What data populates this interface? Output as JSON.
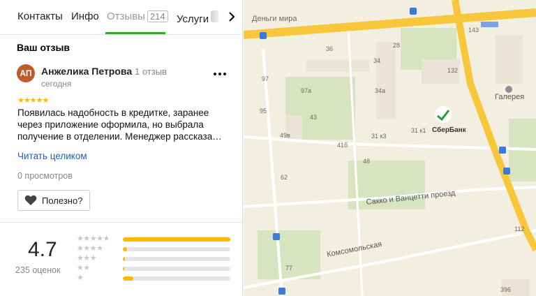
{
  "tabs": {
    "contacts": "Контакты",
    "info": "Инфо",
    "reviews": "Отзывы",
    "reviews_count": "214",
    "services": "Услуги"
  },
  "review": {
    "section_title": "Ваш отзыв",
    "avatar_initials": "АП",
    "author_name": "Анжелика Петрова",
    "author_reviews": "1 отзыв",
    "date": "сегодня",
    "stars": "★★★★★",
    "text": "Появилась надобность в кредитке, заранее через приложение оформила, но выбрала получение в отделении. Менеджер рассказа…",
    "read_more": "Читать целиком",
    "views": "0 просмотров",
    "useful_label": "Полезно?"
  },
  "rating": {
    "value": "4.7",
    "count_label": "235 оценок",
    "distribution": [
      {
        "stars": "★★★★★",
        "fraction": 1.0
      },
      {
        "stars": "★★★★",
        "fraction": 0.04
      },
      {
        "stars": "★★★",
        "fraction": 0.02
      },
      {
        "stars": "★★",
        "fraction": 0.01
      },
      {
        "stars": "★",
        "fraction": 0.1
      }
    ]
  },
  "map": {
    "streets": {
      "dengi_mira": "Деньги мира",
      "sakko": "Сакко и Ванцетти проезд",
      "komsomolskaya": "Комсомольская"
    },
    "pois": {
      "sberbank": "СберБанк",
      "galereya": "Галерея"
    },
    "house_numbers": [
      "143",
      "36",
      "28",
      "34",
      "132",
      "97",
      "97а",
      "34а",
      "95",
      "43",
      "49в",
      "41б",
      "31 к3",
      "31 к1",
      "48",
      "62",
      "112",
      "77",
      "396"
    ],
    "colors": {
      "road": "#f7c63b",
      "park": "#d8e3c0",
      "block": "#e9e4d4",
      "sber_green": "#21a038",
      "bus_stop": "#3c7ad9"
    }
  }
}
